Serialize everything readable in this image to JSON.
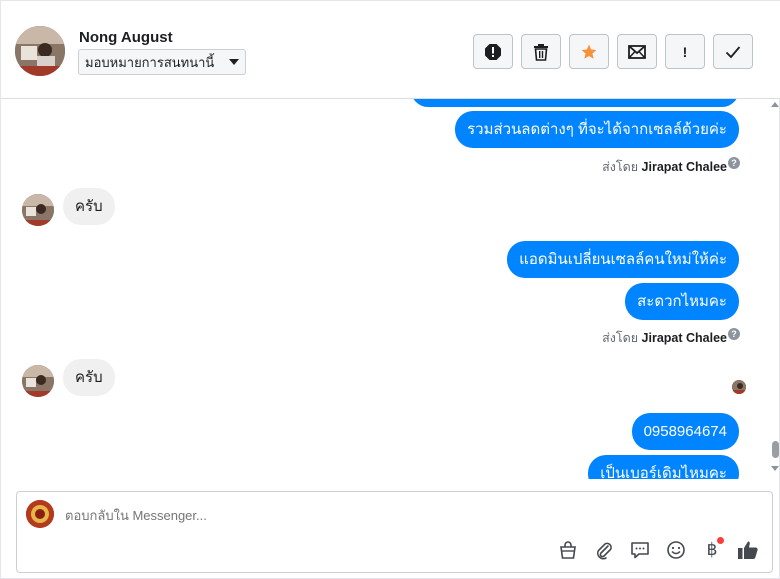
{
  "header": {
    "name": "Nong August",
    "assign_label": "มอบหมายการสนทนานี้",
    "actions": [
      "spam",
      "delete",
      "star",
      "mark-unread",
      "follow-up",
      "done"
    ],
    "action_important_glyph": "!"
  },
  "messages": {
    "out_1": "รวมส่วนลดต่างๆ ที่จะได้จากเซลล์ด้วยค่ะ",
    "sent_by_prefix": "ส่งโดย",
    "sent_by_name": "Jirapat Chalee",
    "help_glyph": "?",
    "in_1": "ครับ",
    "out_2": "แอดมินเปลี่ยนเซลล์คนใหม่ให้ค่ะ",
    "out_3": "สะดวกไหมคะ",
    "in_2": "ครับ",
    "out_4": "0958964674",
    "out_5": "เป็นเบอร์เดิมไหมคะ"
  },
  "composer": {
    "placeholder": "ตอบกลับใน Messenger...",
    "currency_glyph": "฿"
  },
  "colors": {
    "outgoing_bubble": "#0084ff",
    "incoming_bubble": "#f0f0f0",
    "star": "#f7923b",
    "notification_dot": "#fa3e3e"
  }
}
